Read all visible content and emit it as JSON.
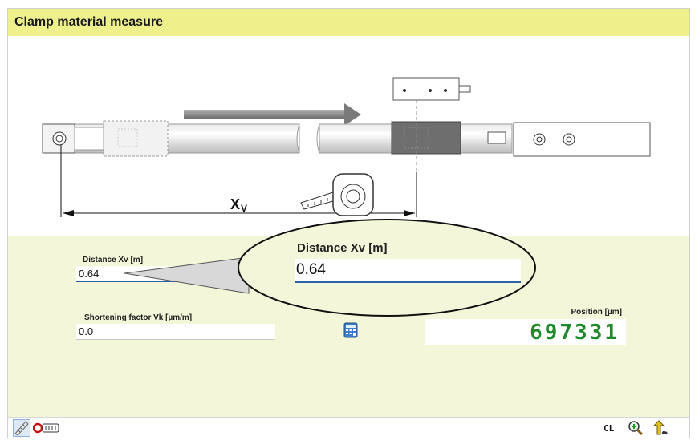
{
  "title": "Clamp material measure",
  "diagram": {
    "dimension_label": "X",
    "dimension_subscript": "V"
  },
  "distance": {
    "label": "Distance Xv [m]",
    "value": "0.64"
  },
  "shortening": {
    "label": "Shortening factor Vk [µm/m]",
    "value": "0.0"
  },
  "magnifier": {
    "label": "Distance Xv [m]",
    "value": "0.64"
  },
  "position": {
    "label": "Position [µm]",
    "value": "697331"
  },
  "toolbar": {
    "cl_label": "CL"
  },
  "icons": {
    "calculator": "calculator-icon",
    "scale": "scale-icon",
    "counter": "counter-icon",
    "zoom": "zoom-in-icon",
    "back": "back-icon"
  },
  "colors": {
    "title_bar": "#eef08c",
    "form_background": "#f3f6d8",
    "position_digits": "#1f8a2c",
    "input_underline": "#2a64a8"
  }
}
